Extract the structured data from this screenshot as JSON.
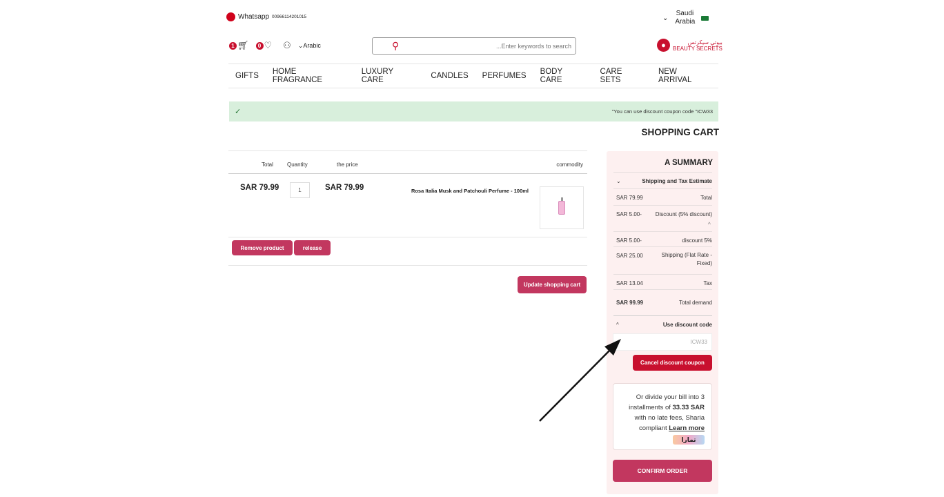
{
  "topbar": {
    "whatsapp_label": "Whatsapp",
    "whatsapp_number": "00966114201015",
    "country_line1": "Saudi",
    "country_line2": "Arabia",
    "chevron": "⌄"
  },
  "header": {
    "cart_count": "1",
    "wishlist_count": "0",
    "language": "⌄Arabic",
    "search_placeholder": "...Enter keywords to search",
    "logo_line1": "بيوتي سيكرتس",
    "logo_line2": "BEAUTY SECRETS"
  },
  "nav": [
    "GIFTS",
    "HOME FRAGRANCE",
    "LUXURY CARE",
    "CANDLES",
    "PERFUMES",
    "BODY CARE",
    "CARE SETS",
    "NEW ARRIVAL"
  ],
  "message": {
    "check": "✓",
    "text": "\"You can use discount coupon code \"ICW33"
  },
  "page_title": "SHOPPING CART",
  "cart": {
    "headers": {
      "total": "Total",
      "quantity": "Quantity",
      "price": "the price",
      "commodity": "commodity"
    },
    "item": {
      "total": "SAR 79.99",
      "quantity": "1",
      "price": "SAR 79.99",
      "name": "Rosa Italia Musk and Patchouli Perfume - 100ml"
    },
    "remove_label": "Remove product",
    "release_label": "release",
    "update_label": "Update shopping cart"
  },
  "summary": {
    "title": "A SUMMARY",
    "shipping_estimate": "Shipping and Tax Estimate",
    "rows": [
      {
        "label": "Total",
        "value": "SAR 79.99"
      },
      {
        "label": "Discount (5% discount)",
        "value": "SAR 5.00-"
      },
      {
        "label": "discount 5%",
        "value": "SAR 5.00-"
      },
      {
        "label": "Shipping (Flat Rate - Fixed)",
        "value": "SAR 25.00"
      },
      {
        "label": "Tax",
        "value": "SAR 13.04"
      },
      {
        "label": "Total demand",
        "value": "SAR 99.99"
      }
    ],
    "use_discount": "Use discount code",
    "coupon_value": "ICW33",
    "cancel_coupon": "Cancel discount coupon",
    "tamara_text_1": "Or divide your bill into 3 installments of",
    "tamara_amount": "33.33 SAR",
    "tamara_text_2": "with no late fees, Sharia compliant",
    "tamara_link": "Learn more",
    "tamara_logo": "تمارا",
    "confirm": "CONFIRM ORDER"
  },
  "colors": {
    "accent": "#c2375f",
    "brand_red": "#c8102e",
    "success_bg": "#d8efdc"
  }
}
